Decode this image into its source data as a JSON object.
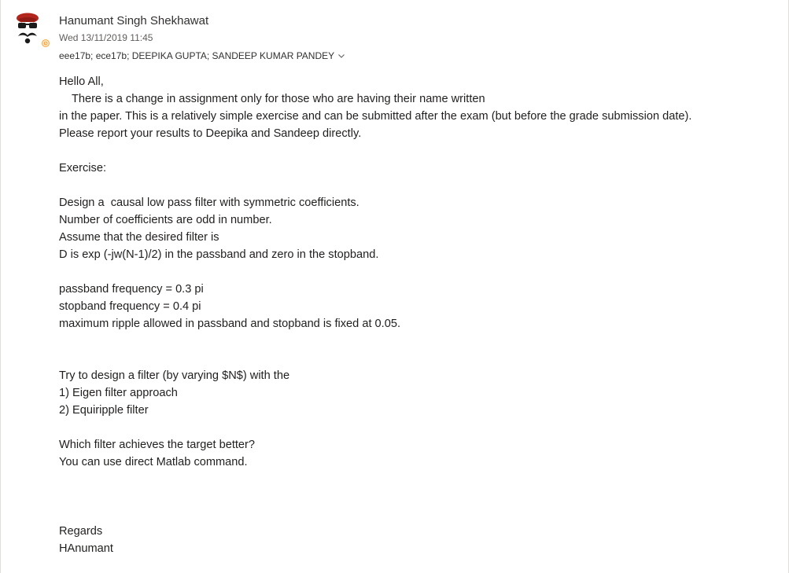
{
  "header": {
    "sender_name": "Hanumant Singh Shekhawat",
    "date": "Wed 13/11/2019 11:45",
    "recipients": "eee17b; ece17b; DEEPIKA GUPTA; SANDEEP KUMAR PANDEY"
  },
  "avatar": {
    "icon": "avatar-icon",
    "presence_color": "#ffaa44",
    "presence_icon": "clock-icon"
  },
  "colors": {
    "text": "#201f1e",
    "muted": "#605e5c",
    "accent_red": "#c42b1c"
  },
  "body": {
    "lines": [
      "Hello All,",
      "    There is a change in assignment only for those who are having their name written",
      "in the paper. This is a relatively simple exercise and can be submitted after the exam (but before the grade submission date).",
      "Please report your results to Deepika and Sandeep directly.",
      "",
      "Exercise:",
      "",
      "Design a  causal low pass filter with symmetric coefficients.",
      "Number of coefficients are odd in number.",
      "Assume that the desired filter is",
      "D is exp (-jw(N-1)/2) in the passband and zero in the stopband.",
      "",
      "passband frequency = 0.3 pi",
      "stopband frequency = 0.4 pi",
      "maximum ripple allowed in passband and stopband is fixed at 0.05.",
      "",
      "",
      "Try to design a filter (by varying $N$) with the",
      "1) Eigen filter approach",
      "2) Equiripple filter",
      "",
      "Which filter achieves the target better?",
      "You can use direct Matlab command.",
      "",
      "",
      "",
      "Regards",
      "HAnumant"
    ]
  }
}
